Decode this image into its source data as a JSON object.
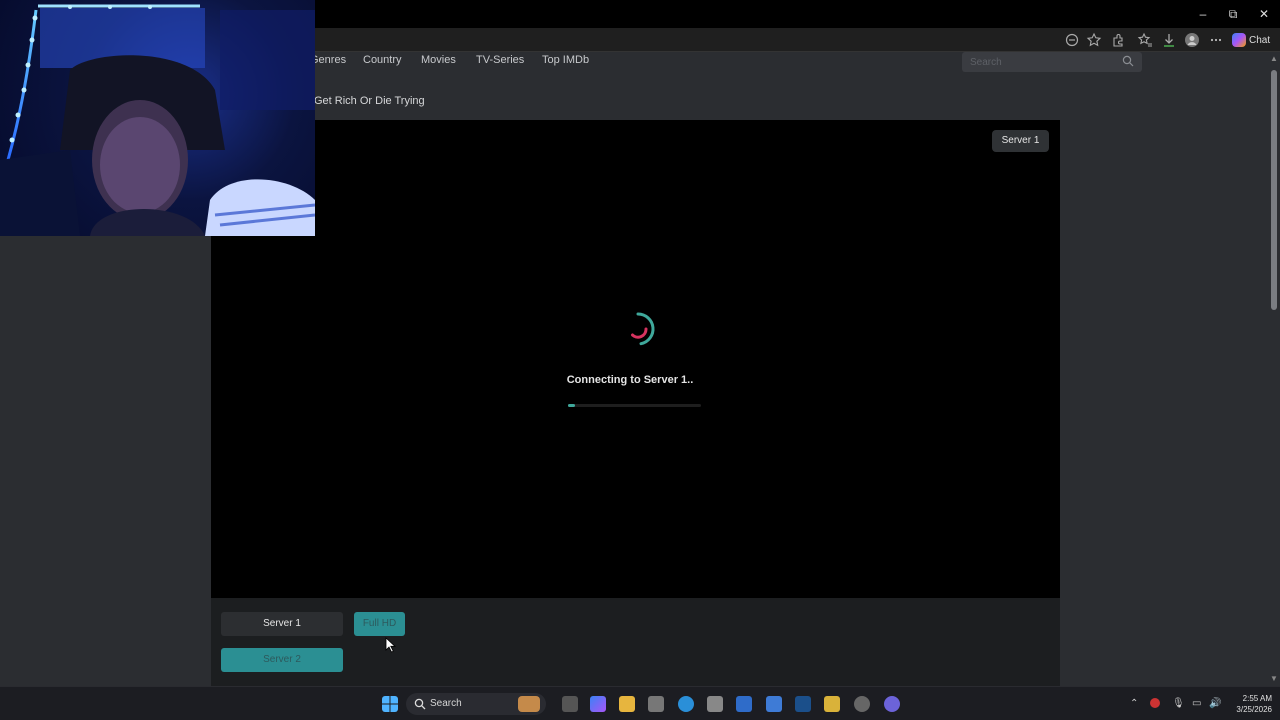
{
  "window": {
    "minimize_label": "–",
    "maximize_label": "⧉",
    "close_label": "✕"
  },
  "toolbar": {
    "chat_label": "Chat"
  },
  "nav": {
    "items": [
      "Genres",
      "Country",
      "Movies",
      "TV-Series",
      "Top IMDb"
    ],
    "search_placeholder": "Search"
  },
  "movie": {
    "title": "Get Rich Or Die Trying"
  },
  "player": {
    "server_badge": "Server 1",
    "status_text": "Connecting to Server 1..",
    "progress_fraction": 0.05,
    "spinner_colors": {
      "arc_outer": "#3fa89b",
      "arc_inner": "#d6335f"
    }
  },
  "servers": {
    "server1_label": "Server 1",
    "fullhd_label": "Full HD",
    "server2_label": "Server 2"
  },
  "taskbar": {
    "search_label": "Search",
    "time": "2:55 AM",
    "date": "3/25/2026"
  },
  "colors": {
    "accent_teal": "#2b8f93",
    "page_bg": "#2b2d31",
    "player_bg": "#000000"
  }
}
